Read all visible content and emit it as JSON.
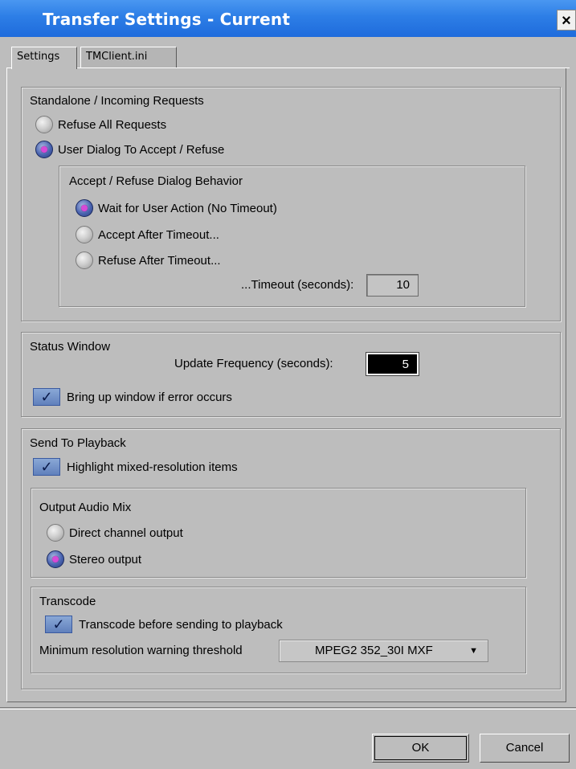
{
  "window": {
    "title": "Transfer Settings - Current",
    "close_glyph": "×"
  },
  "tabs": [
    {
      "label": "Settings",
      "active": true
    },
    {
      "label": "TMClient.ini",
      "active": false
    }
  ],
  "standalone": {
    "legend": "Standalone / Incoming Requests",
    "options": [
      {
        "label": "Refuse All Requests",
        "selected": false
      },
      {
        "label": "User Dialog To Accept / Refuse",
        "selected": true
      }
    ],
    "dialog_behavior": {
      "legend": "Accept / Refuse Dialog Behavior",
      "options": [
        {
          "label": "Wait for User Action (No Timeout)",
          "selected": true
        },
        {
          "label": "Accept After Timeout...",
          "selected": false
        },
        {
          "label": "Refuse After Timeout...",
          "selected": false
        }
      ],
      "timeout_label": "...Timeout (seconds):",
      "timeout_value": "10"
    }
  },
  "status_window": {
    "legend": "Status Window",
    "freq_label": "Update Frequency (seconds):",
    "freq_value": "5",
    "error_checkbox": {
      "label": "Bring up window if error occurs",
      "checked": true
    }
  },
  "send_to_playback": {
    "legend": "Send To Playback",
    "highlight_checkbox": {
      "label": "Highlight mixed-resolution items",
      "checked": true
    },
    "audio_mix": {
      "legend": "Output Audio Mix",
      "options": [
        {
          "label": "Direct channel output",
          "selected": false
        },
        {
          "label": "Stereo output",
          "selected": true
        }
      ]
    },
    "transcode": {
      "legend": "Transcode",
      "checkbox": {
        "label": "Transcode before sending to playback",
        "checked": true
      },
      "threshold_label": "Minimum resolution warning threshold",
      "threshold_value": "MPEG2 352_30I  MXF"
    }
  },
  "buttons": {
    "ok": "OK",
    "cancel": "Cancel"
  },
  "icons": {
    "checkmark": "✓",
    "dropdown": "▼"
  },
  "colors": {
    "titlebar": "#2d7ee6",
    "window_bg": "#bdbdbd",
    "radio_dot": "#d64ad6",
    "check_bg": "#7090c8"
  }
}
